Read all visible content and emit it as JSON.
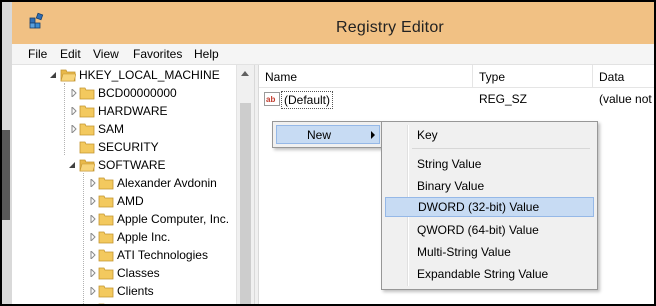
{
  "window": {
    "title": "Registry Editor"
  },
  "menu": [
    "File",
    "Edit",
    "View",
    "Favorites",
    "Help"
  ],
  "tree": {
    "items": [
      {
        "label": "HKEY_LOCAL_MACHINE",
        "expanded": true
      },
      {
        "label": "BCD00000000",
        "expanded": false
      },
      {
        "label": "HARDWARE",
        "expanded": false
      },
      {
        "label": "SAM",
        "expanded": false
      },
      {
        "label": "SECURITY",
        "expanded": false
      },
      {
        "label": "SOFTWARE",
        "expanded": true
      },
      {
        "label": "Alexander Avdonin",
        "expanded": false
      },
      {
        "label": "AMD",
        "expanded": false
      },
      {
        "label": "Apple Computer, Inc.",
        "expanded": false
      },
      {
        "label": "Apple Inc.",
        "expanded": false
      },
      {
        "label": "ATI Technologies",
        "expanded": false
      },
      {
        "label": "Classes",
        "expanded": false
      },
      {
        "label": "Clients",
        "expanded": false
      }
    ]
  },
  "list": {
    "columns": [
      "Name",
      "Type",
      "Data"
    ],
    "rows": [
      {
        "name": "(Default)",
        "type": "REG_SZ",
        "data": "(value not"
      }
    ]
  },
  "context_menu": {
    "parent_item": "New",
    "submenu": [
      "Key",
      "String Value",
      "Binary Value",
      "DWORD (32-bit) Value",
      "QWORD (64-bit) Value",
      "Multi-String Value",
      "Expandable String Value"
    ],
    "highlighted": "DWORD (32-bit) Value"
  },
  "colors": {
    "titlebar": "#f1c184",
    "menu_highlight": "#c7dbf3",
    "menu_highlight_border": "#95b8e7",
    "folder": "#e8b84a"
  }
}
